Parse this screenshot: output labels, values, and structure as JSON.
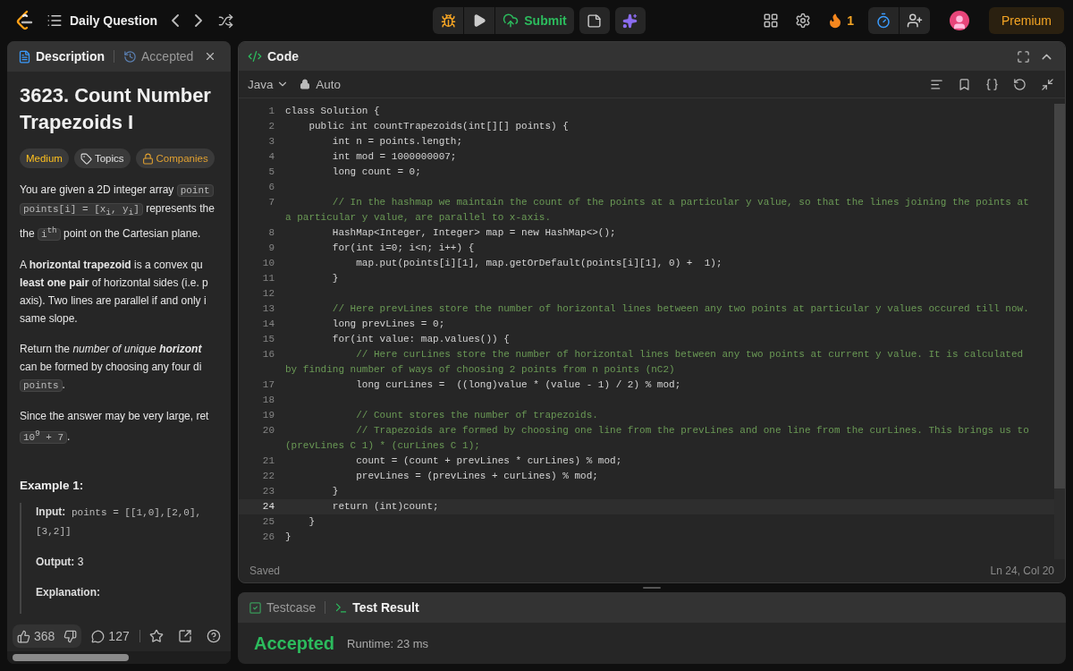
{
  "top_bar": {
    "title": "Daily Question",
    "submit": "Submit",
    "streak": "1",
    "premium": "Premium"
  },
  "left_panel": {
    "tabs": [
      {
        "label": "Description",
        "selected": true,
        "closable": false
      },
      {
        "label": "Accepted",
        "selected": false,
        "closable": true
      }
    ],
    "title_lines": [
      "3623. Count Number",
      "Trapezoids I"
    ],
    "tags": [
      {
        "label": "Medium",
        "kind": "difficulty"
      },
      {
        "label": "Topics",
        "kind": "topics"
      },
      {
        "label": "Companies",
        "kind": "companies"
      }
    ],
    "paragraphs": [
      [
        [
          {
            "kind": "text",
            "text": "You are given a 2D integer array "
          },
          {
            "kind": "code",
            "text": "point"
          }
        ],
        [
          {
            "kind": "code",
            "text": "points[i] = [x$_{i}$, y$_{i}$]"
          },
          {
            "kind": "text",
            "text": " represents the"
          }
        ],
        [
          {
            "kind": "text",
            "text": "the "
          },
          {
            "kind": "code",
            "text": "i$^{th}$"
          },
          {
            "kind": "text",
            "text": " point on the Cartesian plane."
          }
        ]
      ],
      [
        [
          {
            "kind": "text",
            "text": "A **horizontal trapezoid** is a convex qu"
          }
        ],
        [
          {
            "kind": "text",
            "text": "**least one pair** of horizontal sides (i.e. p"
          }
        ],
        [
          {
            "kind": "text",
            "text": "axis). Two lines are parallel if and only i"
          }
        ],
        [
          {
            "kind": "text",
            "text": "same slope."
          }
        ]
      ],
      [
        [
          {
            "kind": "text",
            "text": "Return the *number of unique* "
          },
          {
            "kind": "bold_italic",
            "text": "horizont"
          }
        ],
        [
          {
            "kind": "text",
            "text": "can be formed by choosing any four di"
          }
        ],
        [
          {
            "kind": "code",
            "text": "points"
          },
          {
            "kind": "text",
            "text": "."
          }
        ]
      ],
      [
        [
          {
            "kind": "text",
            "text": "Since the answer may be very large, ret"
          }
        ],
        [
          {
            "kind": "code",
            "text": "10$^{9}$ + 7"
          },
          {
            "kind": "text",
            "text": "."
          }
        ]
      ]
    ],
    "example": {
      "heading": "Example 1:",
      "blocks": [
        [
          [
            {
              "kind": "label",
              "text": "Input:"
            },
            {
              "kind": "mono",
              "text": " points = [[1,0],[2,0],"
            }
          ],
          [
            {
              "kind": "mono",
              "text": "[3,2]]"
            }
          ]
        ],
        [
          [
            {
              "kind": "label",
              "text": "Output:"
            },
            {
              "kind": "text",
              "text": " 3"
            }
          ]
        ],
        [
          [
            {
              "kind": "label",
              "text": "Explanation:"
            }
          ]
        ]
      ]
    },
    "footer": {
      "likes": "368",
      "comments": "127"
    }
  },
  "code_panel": {
    "title": "Code",
    "language": "Java",
    "mode": "Auto",
    "lines": [
      {
        "no": "1",
        "kind": "code",
        "text": "class Solution {",
        "current": false
      },
      {
        "no": "2",
        "kind": "code",
        "text": "    public int countTrapezoids(int[][] points) {",
        "current": false
      },
      {
        "no": "3",
        "kind": "code",
        "text": "        int n = points.length;",
        "current": false
      },
      {
        "no": "4",
        "kind": "code",
        "text": "        int mod = 1000000007;",
        "current": false
      },
      {
        "no": "5",
        "kind": "code",
        "text": "        long count = 0;",
        "current": false
      },
      {
        "no": "6",
        "kind": "blank",
        "current": false
      },
      {
        "no": "7",
        "kind": "comment",
        "text": "        // In the hashmap we maintain the count of the points at a particular y value, so that the lines joining the points at",
        "wrap": "a particular y value, are parallel to x-axis.",
        "current": false
      },
      {
        "no": "8",
        "kind": "code",
        "text": "        HashMap<Integer, Integer> map = new HashMap<>();",
        "current": false
      },
      {
        "no": "9",
        "kind": "code",
        "text": "        for(int i=0; i<n; i++) {",
        "current": false
      },
      {
        "no": "10",
        "kind": "code",
        "text": "            map.put(points[i][1], map.getOrDefault(points[i][1], 0) +  1);",
        "current": false
      },
      {
        "no": "11",
        "kind": "code",
        "text": "        }",
        "current": false
      },
      {
        "no": "12",
        "kind": "blank",
        "current": false
      },
      {
        "no": "13",
        "kind": "comment",
        "text": "        // Here prevLines store the number of horizontal lines between any two points at particular y values occured till now.",
        "current": false
      },
      {
        "no": "14",
        "kind": "code",
        "text": "        long prevLines = 0;",
        "current": false
      },
      {
        "no": "15",
        "kind": "code",
        "text": "        for(int value: map.values()) {",
        "current": false
      },
      {
        "no": "16",
        "kind": "comment",
        "text": "            // Here curLines store the number of horizontal lines between any two points at current y value. It is calculated",
        "wrap": "by finding number of ways of choosing 2 points from n points (nC2)",
        "current": false
      },
      {
        "no": "17",
        "kind": "code",
        "text": "            long curLines =  ((long)value * (value - 1) / 2) % mod;",
        "current": false
      },
      {
        "no": "18",
        "kind": "blank",
        "current": false
      },
      {
        "no": "19",
        "kind": "comment",
        "text": "            // Count stores the number of trapezoids.",
        "current": false
      },
      {
        "no": "20",
        "kind": "comment",
        "text": "            // Trapezoids are formed by choosing one line from the prevLines and one line from the curLines. This brings us to",
        "wrap": "(prevLines C 1) * (curLines C 1);",
        "current": false
      },
      {
        "no": "21",
        "kind": "code",
        "text": "            count = (count + prevLines * curLines) % mod;",
        "current": false
      },
      {
        "no": "22",
        "kind": "code",
        "text": "            prevLines = (prevLines + curLines) % mod;",
        "current": false
      },
      {
        "no": "23",
        "kind": "code",
        "text": "        }",
        "current": false
      },
      {
        "no": "24",
        "kind": "code",
        "text": "        return (int)count;",
        "current": true
      },
      {
        "no": "25",
        "kind": "code",
        "text": "    }",
        "current": false
      },
      {
        "no": "26",
        "kind": "code",
        "text": "}",
        "current": false
      }
    ],
    "status": "Saved",
    "cursor": "Ln 24, Col 20"
  },
  "result_panel": {
    "tabs": [
      {
        "label": "Testcase",
        "selected": false
      },
      {
        "label": "Test Result",
        "selected": true
      }
    ],
    "verdict": "Accepted",
    "runtime": "Runtime: 23 ms"
  }
}
